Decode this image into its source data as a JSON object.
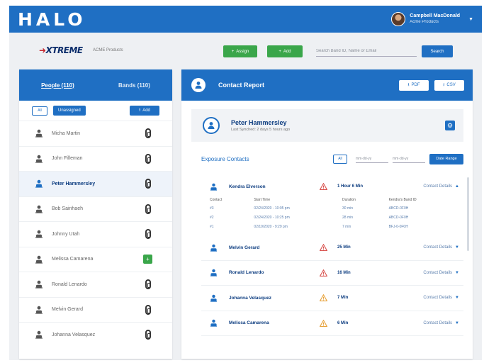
{
  "app": {
    "title": "HALO"
  },
  "user": {
    "name": "Campbell MacDonald",
    "org": "Acme Products"
  },
  "subheader": {
    "logo_text": "XTREME",
    "product": "ACME Products",
    "assign_label": "Assign",
    "add_label": "Add",
    "search_placeholder": "Search Band ID, Name or Email",
    "search_label": "Search"
  },
  "left": {
    "tabs": [
      {
        "label": "People (110)"
      },
      {
        "label": "Bands (110)"
      }
    ],
    "all_label": "All",
    "unassigned_label": "Unassigned",
    "add_label": "Add",
    "people": [
      {
        "name": "Micha Martin",
        "band": "band",
        "selected": false
      },
      {
        "name": "John Filleman",
        "band": "band",
        "selected": false
      },
      {
        "name": "Peter Hammersley",
        "band": "band",
        "selected": true
      },
      {
        "name": "Bob Sainhaeh",
        "band": "band",
        "selected": false
      },
      {
        "name": "Johnny Utah",
        "band": "band",
        "selected": false
      },
      {
        "name": "Melissa Camarena",
        "band": "add",
        "add_symbol": "+",
        "selected": false
      },
      {
        "name": "Ronald Lenardo",
        "band": "band",
        "selected": false
      },
      {
        "name": "Melvin Gerard",
        "band": "band",
        "selected": false
      },
      {
        "name": "Johanna Velasquez",
        "band": "band",
        "selected": false
      }
    ]
  },
  "report": {
    "title": "Contact Report",
    "pdf_label": "PDF",
    "csv_label": "CSV",
    "profile": {
      "name": "Peter Hammersley",
      "sync": "Last Synched: 2 days 5 hours ago"
    },
    "exposure_title": "Exposure Contacts",
    "all_label": "All",
    "date_from_placeholder": "mm-dd-yy",
    "date_to_placeholder": "mm-dd-yy",
    "date_range_label": "Date Range",
    "details_label": "Contact Details",
    "expanded": {
      "name": "Kendra Elverson",
      "duration": "1 Hour 6 Min",
      "warn_color": "#d9534f",
      "columns": [
        "Contact",
        "Start Time",
        "Duration",
        "Kendra's Band ID"
      ],
      "rows": [
        [
          "#3",
          "02/24/2020 - 10:05 pm",
          "30 min",
          "ABCD-0F0H"
        ],
        [
          "#2",
          "02/24/2020 - 10:25 pm",
          "28 min",
          "ABCD-0F0H"
        ],
        [
          "#1",
          "02/19/2020 - 9:29 pm",
          "7 min",
          "BFJ-0-0F0H"
        ]
      ]
    },
    "contacts": [
      {
        "name": "Melvin Gerard",
        "duration": "25 Min",
        "warn_color": "#d9534f"
      },
      {
        "name": "Ronald Lenardo",
        "duration": "16 Min",
        "warn_color": "#d9534f"
      },
      {
        "name": "Johanna Velasquez",
        "duration": "7 Min",
        "warn_color": "#e8a33c"
      },
      {
        "name": "Melissa Camarena",
        "duration": "6 Min",
        "warn_color": "#e8a33c"
      }
    ]
  },
  "colors": {
    "primary": "#1f6fc3",
    "green": "#3aa64a",
    "danger": "#d9534f",
    "warning": "#e8a33c"
  }
}
